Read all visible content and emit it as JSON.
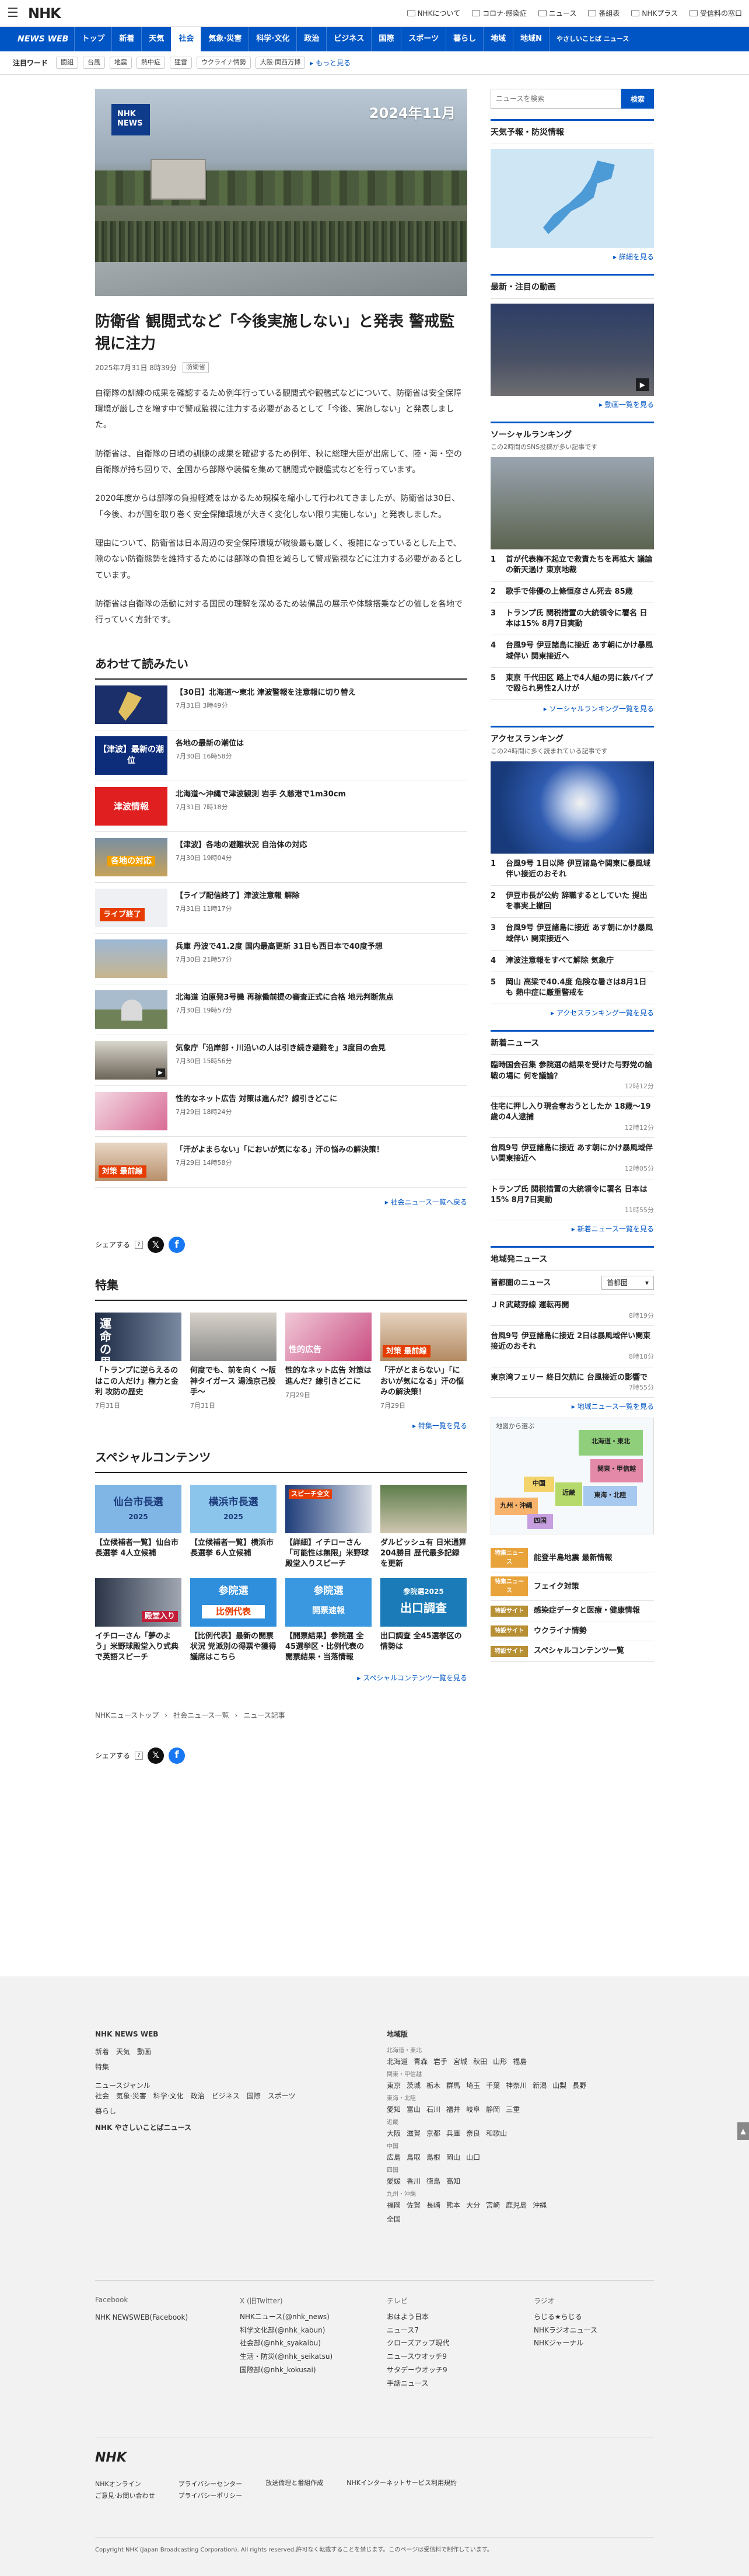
{
  "header": {
    "brand": "NHK",
    "links": [
      "NHKについて",
      "コロナ·感染症",
      "ニュース",
      "番組表",
      "NHKプラス",
      "受信料の窓口"
    ]
  },
  "nav": {
    "logo": "NEWS WEB",
    "items": [
      "トップ",
      "新着",
      "天気",
      "社会",
      "気象·災害",
      "科学·文化",
      "政治",
      "ビジネス",
      "国際",
      "スポーツ",
      "暮らし",
      "地域",
      "地域N"
    ],
    "active": 3,
    "small": "やさしいことば ニュース"
  },
  "tags": {
    "label": "注目ワード",
    "items": [
      "闘組",
      "台風",
      "地震",
      "熱中症",
      "猛雷",
      "ウクライナ情勢",
      "大阪·関西万博"
    ],
    "more": "もっと見る"
  },
  "article": {
    "hero": {
      "badge_line1": "NHK",
      "badge_line2": "NEWS",
      "date": "2024年11月"
    },
    "title": "防衛省 観閲式など「今後実施しない」と発表 警戒監視に注力",
    "date": "2025年7月31日 8時39分",
    "category": "防衛省",
    "paragraphs": [
      "自衛隊の訓練の成果を確認するため例年行っている観閲式や観艦式などについて、防衛省は安全保障環境が厳しさを増す中で警戒監視に注力する必要があるとして「今後、実施しない」と発表しました。",
      "防衛省は、自衛隊の日頃の訓練の成果を確認するため例年、秋に総理大臣が出席して、陸・海・空の自衛隊が持ち回りで、全国から部隊や装備を集めて観閲式や観艦式などを行っています。",
      "2020年度からは部隊の負担軽減をはかるため規模を縮小して行われてきましたが、防衛省は30日、「今後、わが国を取り巻く安全保障環境が大きく変化しない限り実施しない」と発表しました。",
      "理由について、防衛省は日本周辺の安全保障環境が戦後最も厳しく、複雑になっているとした上で、隙のない防衛態勢を維持するためには部隊の負担を減らして警戒監視などに注力する必要があるとしています。",
      "防衛省は自衛隊の活動に対する国民の理解を深めるため装備品の展示や体験搭乗などの催しを各地で行っていく方針です。"
    ]
  },
  "related": {
    "heading": "あわせて読みたい",
    "items": [
      {
        "title": "【30日】北海道〜東北 津波警報を注意報に切り替え",
        "date": "7月31日 3時49分",
        "thumb": "map"
      },
      {
        "title": "各地の最新の潮位は",
        "date": "7月30日 16時58分",
        "thumb": "blue",
        "thumb_text": "【津波】最新の潮位"
      },
      {
        "title": "北海道〜沖縄で津波観測 岩手 久慈港で1m30cm",
        "date": "7月31日 7時18分",
        "thumb": "red",
        "thumb_text": "津波情報"
      },
      {
        "title": "【津波】各地の避難状況 自治体の対応",
        "date": "7月30日 19時04分",
        "thumb": "orange",
        "thumb_text": "各地の対応"
      },
      {
        "title": "【ライブ配信終了】津波注意報 解除",
        "date": "7月31日 11時17分",
        "thumb": "live",
        "thumb_text": "ライブ終了"
      },
      {
        "title": "兵庫 丹波で41.2度 国内最高更新 31日も西日本で40度予想",
        "date": "7月30日 21時57分",
        "thumb": "heat"
      },
      {
        "title": "北海道 泊原発3号機 再稼働前提の審査正式に合格 地元判断焦点",
        "date": "7月30日 19時57分",
        "thumb": "plant"
      },
      {
        "title": "気象庁「沿岸部・川沿いの人は引き続き避難を」3度目の会見",
        "date": "7月30日 15時56分",
        "thumb": "press"
      },
      {
        "title": "性的なネット広告 対策は進んだ？線引きどこに",
        "date": "7月29日 18時24分",
        "thumb": "phone"
      },
      {
        "title": "「汗がよまらない」「においが気になる」汗の悩みの解決策！",
        "date": "7月29日 14時58分",
        "thumb": "sweat",
        "thumb_text": "対策 最前線"
      }
    ],
    "more": "社会ニュース一覧へ戻る"
  },
  "share": {
    "label": "シェアする"
  },
  "features": {
    "heading": "特集",
    "items": [
      {
        "title": "「トランプに逆らえるのはこの人だけ」権力と金利 攻防の歴史",
        "date": "7月31日",
        "thumb_text": "運命の男"
      },
      {
        "title": "何度でも、前を向く 〜阪神タイガース 湯浅京己投手〜",
        "date": "7月31日",
        "thumb_text": ""
      },
      {
        "title": "性的なネット広告 対策は進んだ？線引きどこに",
        "date": "7月29日",
        "thumb_text": "性的広告"
      },
      {
        "title": "「汗がとまらない」「においが気になる」汗の悩みの解決策！",
        "date": "7月29日",
        "thumb_text": "対策 最前線"
      }
    ],
    "more": "特集一覧を見る"
  },
  "special": {
    "heading": "スペシャルコンテンツ",
    "items": [
      {
        "title": "【立候補者一覧】仙台市長選挙 4人立候補",
        "thumb_text": "仙台市長選",
        "thumb_sub": "2025"
      },
      {
        "title": "【立候補者一覧】横浜市長選挙 6人立候補",
        "thumb_text": "横浜市長選",
        "thumb_sub": "2025"
      },
      {
        "title": "【詳細】イチローさん「可能性は無限」米野球殿堂入りスピーチ",
        "thumb_text": "スピーチ全文"
      },
      {
        "title": "ダルビッシュ有 日米通算204勝目 歴代最多記録を更新",
        "thumb_text": ""
      },
      {
        "title": "イチローさん「夢のよう」米野球殿堂入り式典で英語スピーチ",
        "thumb_text": "殿堂入り"
      },
      {
        "title": "【比例代表】最新の開票状況 党派別の得票や獲得議席はこちら",
        "thumb_text": "参院選",
        "thumb_sub": "比例代表"
      },
      {
        "title": "【開票結果】参院選 全45選挙区・比例代表の開票結果・当落情報",
        "thumb_text": "参院選",
        "thumb_sub": "開票速報"
      },
      {
        "title": "出口調査 全45選挙区の情勢は",
        "thumb_text": "出口調査",
        "thumb_sub": "参院選2025"
      }
    ],
    "more": "スペシャルコンテンツ一覧を見る"
  },
  "breadcrumb": [
    "NHKニューストップ",
    "社会ニュース一覧",
    "ニュース記事"
  ],
  "side": {
    "search_placeholder": "ニュースを検索",
    "search_button": "検索",
    "weather": {
      "heading": "天気予報・防災情報",
      "more": "詳細を見る"
    },
    "video": {
      "heading": "最新・注目の動画",
      "more": "動画一覧を見る"
    },
    "social": {
      "heading": "ソーシャルランキング",
      "sub": "この2時間のSNS投稿が多い記事です",
      "items": [
        "首が代表権不起立で救責たちを再拡大 議論の新天過け 東京地裁",
        "歌手で俳優の上條恒彦さん死去 85歳",
        "トランプ氏 関税措置の大統領令に署名 日本は15% 8月7日実動",
        "台風9号 伊豆諸島に接近 あす朝にかけ暴風域伴い 関東接近へ",
        "東京 千代田区 路上で4人組の男に鉄パイプで殴られ男性2人けが"
      ],
      "more": "ソーシャルランキング一覧を見る"
    },
    "access": {
      "heading": "アクセスランキング",
      "sub": "この24時間に多く読まれている記事です",
      "items": [
        "台風9号 1日以降 伊豆諸島や関東に暴風域伴い接近のおそれ",
        "伊豆市長が公約 辞職するとしていた 提出を事実上撤回",
        "台風9号 伊豆諸島に接近 あす朝にかけ暴風域伴い 関東接近へ",
        "津波注意報をすべて解除 気象庁",
        "岡山 高梁で40.4度 危険な暑さは8月1日も 熱中症に厳重警戒を"
      ],
      "more": "アクセスランキング一覧を見る"
    },
    "latest": {
      "heading": "新着ニュース",
      "items": [
        {
          "title": "臨時国会召集 参院選の結果を受けた与野党の論戦の場に 何を議論？",
          "time": "12時12分"
        },
        {
          "title": "住宅に押し入り現金奪おうとしたか 18歳〜19歳の4人逮捕",
          "time": "12時12分"
        },
        {
          "title": "台風9号 伊豆諸島に接近 あす朝にかけ暴風域伴い関東接近へ",
          "time": "12時05分"
        },
        {
          "title": "トランプ氏 関税措置の大統領令に署名 日本は15% 8月7日実動",
          "time": "11時55分"
        }
      ],
      "more": "新着ニュース一覧を見る"
    },
    "regional": {
      "heading": "地域発ニュース",
      "area_label": "首都圏のニュース",
      "select": "首都圏",
      "items": [
        {
          "title": "ＪＲ武蔵野線 運転再開",
          "time": "8時19分"
        },
        {
          "title": "台風9号 伊豆諸島に接近 2日は暴風域伴い関東接近のおそれ",
          "time": "8時18分"
        },
        {
          "title": "東京湾フェリー 終日欠航に 台風接近の影響で",
          "time": "7時55分"
        }
      ],
      "more": "地域ニュース一覧を見る",
      "map_label": "地図から選ぶ",
      "regions": [
        "北海道・東北",
        "関東・甲信越",
        "中国",
        "近畿",
        "東海・北陸",
        "九州・沖縄",
        "四国"
      ]
    },
    "topics": [
      {
        "tag": "特集ニュース",
        "title": "能登半島地震 最新情報"
      },
      {
        "tag": "特集ニュース",
        "title": "フェイク対策"
      },
      {
        "tag": "特設サイト",
        "title": "感染症データと医療・健康情報"
      },
      {
        "tag": "特設サイト",
        "title": "ウクライナ情勢"
      },
      {
        "tag": "特設サイト",
        "title": "スペシャルコンテンツ一覧"
      }
    ]
  },
  "footer": {
    "brand": "NHK NEWS WEB",
    "col1": [
      "新着",
      "天気",
      "動画",
      "特集"
    ],
    "genre_label": "ニュースジャンル",
    "genres": [
      "社会",
      "気象·災害",
      "科学·文化",
      "政治",
      "ビジネス",
      "国際",
      "スポーツ",
      "暮らし"
    ],
    "easy": "NHK やさしいことばニュース",
    "region_label": "地域版",
    "regions": [
      {
        "area": "北海道・東北",
        "prefs": [
          "北海道",
          "青森",
          "岩手",
          "宮城",
          "秋田",
          "山形",
          "福島"
        ]
      },
      {
        "area": "関東・甲信越",
        "prefs": [
          "東京",
          "茨城",
          "栃木",
          "群馬",
          "埼玉",
          "千葉",
          "神奈川",
          "新潟",
          "山梨",
          "長野"
        ]
      },
      {
        "area": "東海・北陸",
        "prefs": [
          "愛知",
          "富山",
          "石川",
          "福井",
          "岐阜",
          "静岡",
          "三重"
        ]
      },
      {
        "area": "近畿",
        "prefs": [
          "大阪",
          "滋賀",
          "京都",
          "兵庫",
          "奈良",
          "和歌山"
        ]
      },
      {
        "area": "中国",
        "prefs": [
          "広島",
          "鳥取",
          "島根",
          "岡山",
          "山口"
        ]
      },
      {
        "area": "四国",
        "prefs": [
          "愛媛",
          "香川",
          "徳島",
          "高知"
        ]
      },
      {
        "area": "九州・沖縄",
        "prefs": [
          "福岡",
          "佐賀",
          "長崎",
          "熊本",
          "大分",
          "宮崎",
          "鹿児島",
          "沖縄"
        ]
      }
    ],
    "all": "全国",
    "fb_label": "Facebook",
    "fb": [
      "NHK NEWSWEB(Facebook)"
    ],
    "x_label": "X (旧Twitter)",
    "x": [
      "NHKニュース(@nhk_news)",
      "科学文化部(@nhk_kabun)",
      "社会部(@nhk_syakaibu)",
      "生活・防災(@nhk_seikatsu)",
      "国際部(@nhk_kokusai)"
    ],
    "tv_label": "テレビ",
    "tv": [
      "おはよう日本",
      "ニュース7",
      "クローズアップ現代",
      "ニュースウオッチ9",
      "サタデーウオッチ9",
      "手話ニュース"
    ],
    "radio_label": "ラジオ",
    "radio": [
      "らじる★らじる",
      "NHKラジオニュース",
      "NHKジャーナル"
    ],
    "logo": "NHK",
    "links": [
      "NHKオンライン",
      "ご意見·お問い合わせ",
      "プライバシーセンター",
      "プライバシーポリシー",
      "放送倫理と番組作成",
      "NHKインターネットサービス利用規約"
    ],
    "copyright": "Copyright NHK (Japan Broadcasting Corporation). All rights reserved.許可なく転載することを禁じます。このページは受信料で制作しています。"
  }
}
